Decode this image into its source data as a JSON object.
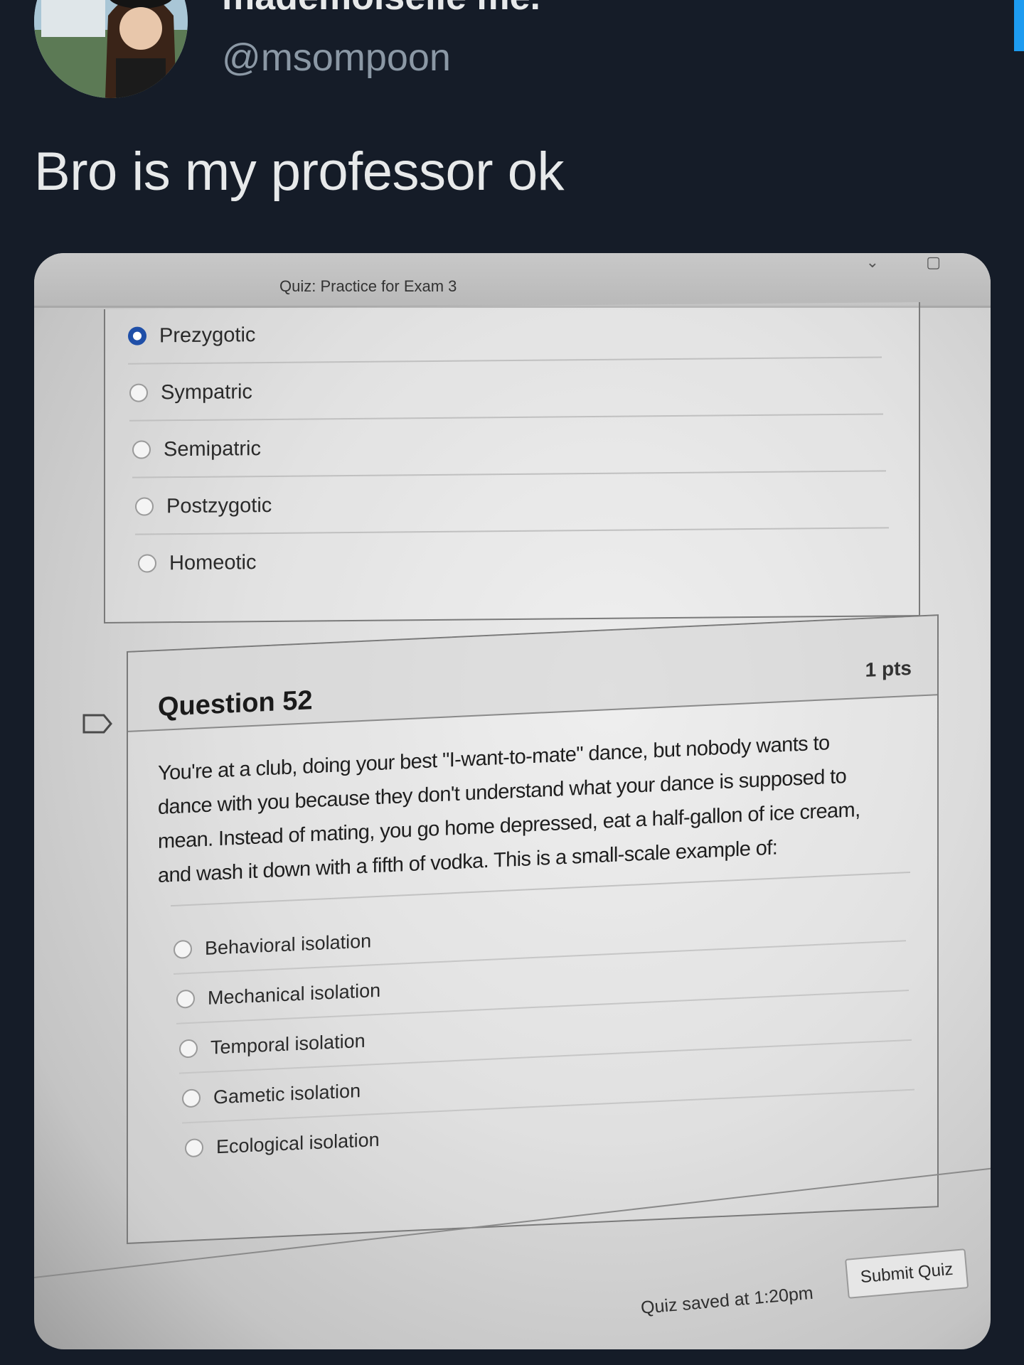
{
  "tweet": {
    "display_name": "mademoiselle me.",
    "handle": "@msompoon",
    "text": "Bro is my professor ok",
    "avatar_icon": "profile-photo"
  },
  "quiz": {
    "title": "Quiz: Practice for Exam 3",
    "previous_question": {
      "options": [
        {
          "label": "Prezygotic",
          "selected": true
        },
        {
          "label": "Sympatric",
          "selected": false
        },
        {
          "label": "Semipatric",
          "selected": false
        },
        {
          "label": "Postzygotic",
          "selected": false
        },
        {
          "label": "Homeotic",
          "selected": false
        }
      ]
    },
    "question": {
      "title": "Question 52",
      "points": "1 pts",
      "text_lines": [
        "You're at a club, doing your best \"I-want-to-mate\" dance, but nobody wants to",
        "dance with you because they don't understand what your dance is supposed to",
        "mean. Instead of mating, you go home depressed, eat a half-gallon of ice cream,",
        "and wash it down with a fifth of vodka. This is a small-scale example of:"
      ],
      "options": [
        {
          "label": "Behavioral isolation",
          "selected": false
        },
        {
          "label": "Mechanical isolation",
          "selected": false
        },
        {
          "label": "Temporal isolation",
          "selected": false
        },
        {
          "label": "Gametic isolation",
          "selected": false
        },
        {
          "label": "Ecological isolation",
          "selected": false
        }
      ],
      "flag_icon": "bookmark-flag-icon"
    },
    "footer": {
      "saved_text": "Quiz saved at 1:20pm",
      "submit_label": "Submit Quiz"
    }
  },
  "colors": {
    "background": "#151c28",
    "selected_radio": "#1f4fa8",
    "accent": "#1d9bf0"
  }
}
